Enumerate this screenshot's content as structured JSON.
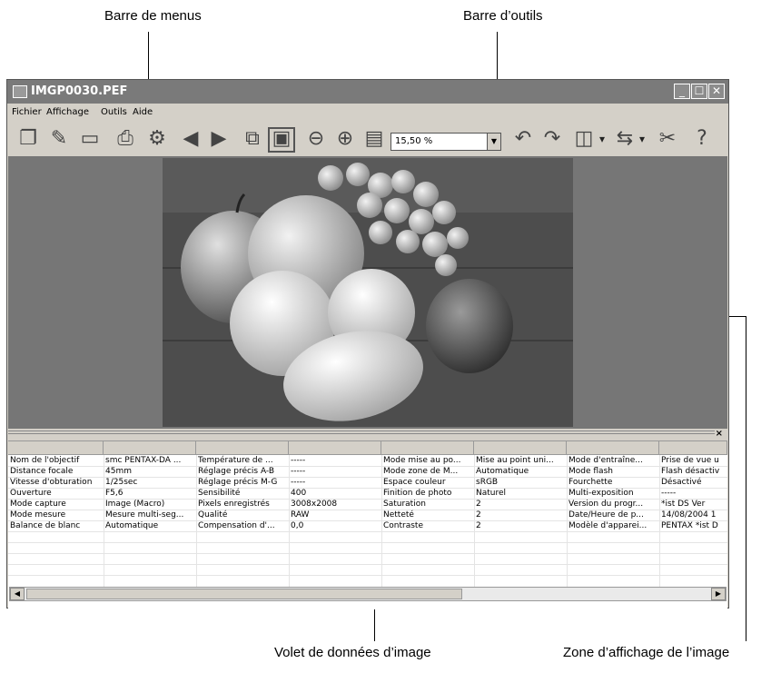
{
  "callouts": {
    "menu_bar": "Barre de menus",
    "toolbar": "Barre d’outils",
    "data_pane": "Volet de données d’image",
    "display_area": "Zone d’affichage de l’image"
  },
  "window": {
    "title": "IMGP0030.PEF",
    "buttons": [
      "minimize",
      "maximize",
      "close"
    ]
  },
  "menu": [
    "Fichier",
    "Affichage",
    "Outils",
    "Aide"
  ],
  "toolbar": {
    "icons": [
      "new-window-icon",
      "open-icon",
      "save-icon",
      "print-icon",
      "settings-icon",
      "previous-icon",
      "next-icon",
      "slideshow-icon",
      "fit-window-icon",
      "zoom-out-icon",
      "zoom-in-icon",
      "actual-size-icon",
      "rotate-left-icon",
      "rotate-right-icon",
      "image-adjust-icon",
      "convert-icon",
      "tools-icon",
      "help-icon"
    ],
    "zoom_value": "15,50 %"
  },
  "image_data": {
    "rows": [
      [
        "Nom de l'objectif",
        "smc PENTAX-DA ...",
        "Température de ...",
        "-----",
        "Mode mise au po...",
        "Mise au point uni...",
        "Mode d'entraîne...",
        "Prise de vue u"
      ],
      [
        "Distance focale",
        "45mm",
        "Réglage précis A-B",
        "-----",
        "Mode zone de M...",
        "Automatique",
        "Mode flash",
        "Flash désactiv"
      ],
      [
        "Vitesse d'obturation",
        "1/25sec",
        "Réglage précis M-G",
        "-----",
        "Espace couleur",
        "sRGB",
        "Fourchette",
        "Désactivé"
      ],
      [
        "Ouverture",
        "F5,6",
        "Sensibilité",
        "400",
        "Finition de photo",
        "Naturel",
        "Multi-exposition",
        "-----"
      ],
      [
        "Mode capture",
        "Image (Macro)",
        "Pixels enregistrés",
        "3008x2008",
        "Saturation",
        "2",
        "Version du progr...",
        "*ist DS   Ver"
      ],
      [
        "Mode mesure",
        "Mesure multi-seg...",
        "Qualité",
        "RAW",
        "Netteté",
        "2",
        "Date/Heure de p...",
        "14/08/2004 1"
      ],
      [
        "Balance de blanc",
        "Automatique",
        "Compensation d'...",
        "0,0",
        "Contraste",
        "2",
        "Modèle d'apparei...",
        "PENTAX *ist D"
      ]
    ]
  },
  "colors": {
    "titlebar": "#7a7a7a",
    "window_bg": "#d4d0c8",
    "viewer_bg": "#767676"
  }
}
